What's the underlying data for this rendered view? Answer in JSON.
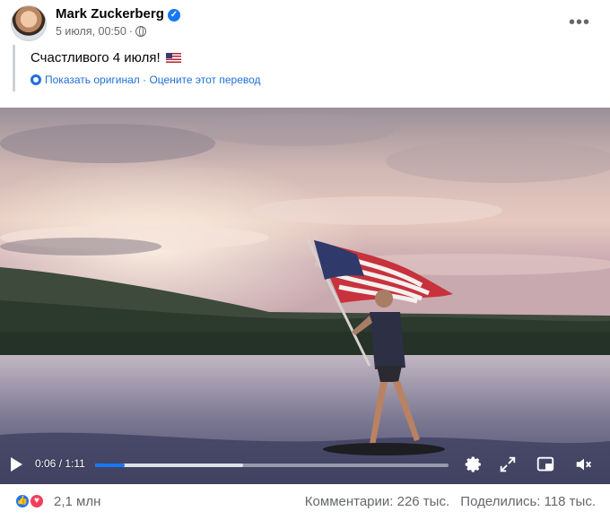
{
  "post": {
    "author": "Mark Zuckerberg",
    "timestamp": "5 июля, 00:50",
    "text": "Счастливого 4 июля!",
    "translation_links": {
      "show_original": "Показать оригинал",
      "separator": "·",
      "rate_translation": "Оцените этот перевод"
    }
  },
  "video": {
    "time": "0:06 / 1:11",
    "progress_fraction": 0.085,
    "buffer_fraction": 0.42
  },
  "footer": {
    "reactions_count": "2,1 млн",
    "comments": "Комментарии: 226 тыс.",
    "shares": "Поделились: 118 тыс."
  },
  "colors": {
    "accent": "#1877f2",
    "link": "#216fdb",
    "muted": "#65676b",
    "love": "#f33e58"
  },
  "icons": [
    "verified-icon",
    "globe-icon",
    "more-icon",
    "translate-gear-icon",
    "play-icon",
    "settings-icon",
    "expand-icon",
    "pip-icon",
    "volume-icon",
    "like-reaction-icon",
    "love-reaction-icon"
  ]
}
